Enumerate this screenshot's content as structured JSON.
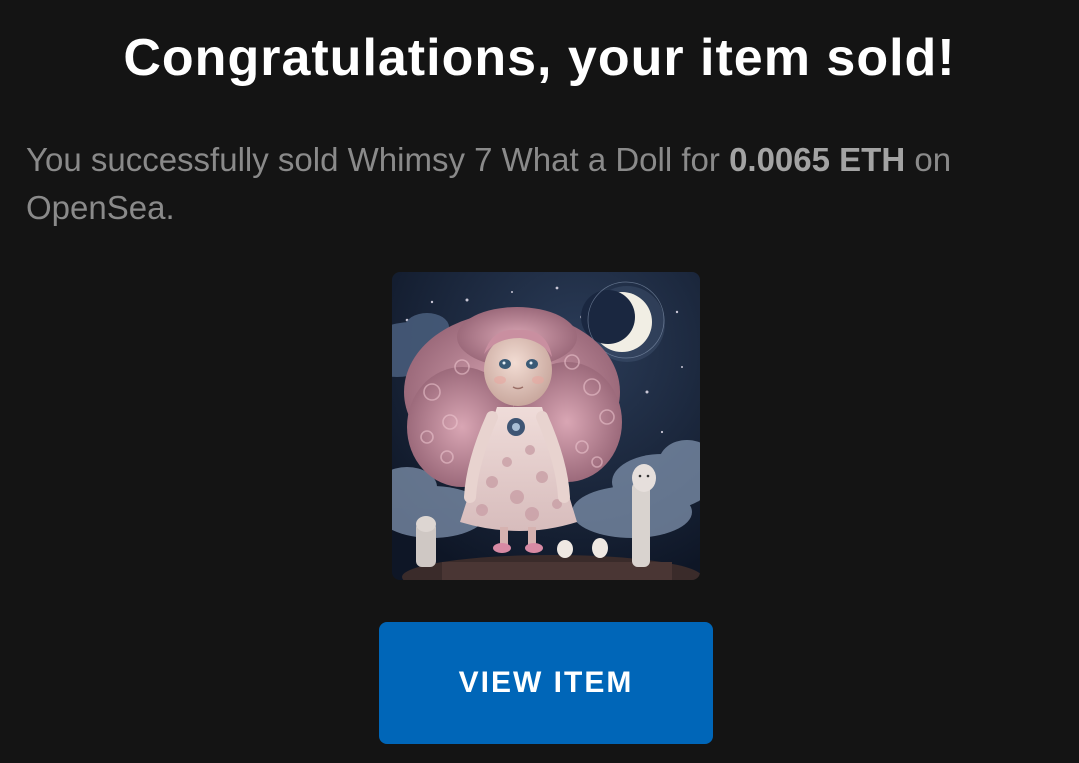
{
  "email": {
    "title": "Congratulations, your item sold!",
    "message_prefix": "You successfully sold ",
    "item_name": "Whimsy 7 What a Doll",
    "message_middle": " for ",
    "price": "0.0065 ETH",
    "message_suffix": " on",
    "marketplace": "OpenSea",
    "message_end": ".",
    "image_icon": "nft-artwork-doll-image",
    "button_label": "VIEW ITEM"
  },
  "colors": {
    "background": "#141414",
    "title": "#ffffff",
    "body_text": "#8a8a8a",
    "button": "#0066b8"
  }
}
